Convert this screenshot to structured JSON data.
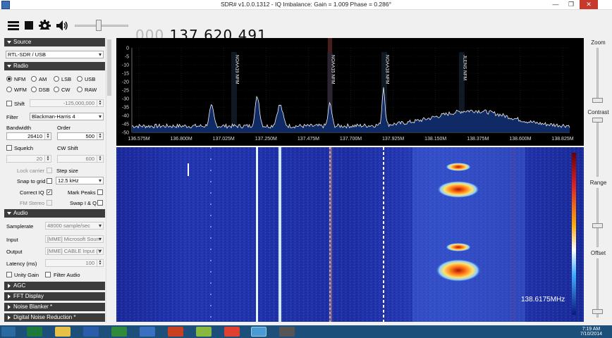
{
  "titlebar": {
    "title": "SDR# v1.0.0.1312 - IQ Imbalance: Gain = 1.009 Phase = 0.286°"
  },
  "toolbar": {
    "freq_dim": "000.",
    "freq_main": "137.620.491"
  },
  "source": {
    "header": "Source",
    "device": "RTL-SDR / USB"
  },
  "radio": {
    "header": "Radio",
    "modes_row1": [
      "NFM",
      "AM",
      "LSB",
      "USB"
    ],
    "modes_row2": [
      "WFM",
      "DSB",
      "CW",
      "RAW"
    ],
    "selected_mode": "NFM",
    "shift_label": "Shift",
    "shift_value": "-125,000,000",
    "filter_label": "Filter",
    "filter_value": "Blackman-Harris 4",
    "bandwidth_label": "Bandwidth",
    "bandwidth_value": "26410",
    "order_label": "Order",
    "order_value": "500",
    "squelch_label": "Squelch",
    "cw_shift_label": "CW Shift",
    "squelch_value": "20",
    "cw_shift_value": "600",
    "lock_carrier_label": "Lock carrier",
    "step_size_label": "Step size",
    "snap_label": "Snap to grid",
    "step_value": "12.5 kHz",
    "correct_iq_label": "Correct IQ",
    "mark_peaks_label": "Mark Peaks",
    "fm_stereo_label": "FM Stereo",
    "swap_iq_label": "Swap I & Q"
  },
  "audio": {
    "header": "Audio",
    "samplerate_label": "Samplerate",
    "samplerate_value": "48000 sample/sec",
    "input_label": "Input",
    "input_value": "[MME] Microsoft Soun",
    "output_label": "Output",
    "output_value": "[MME] CABLE Input (V",
    "latency_label": "Latency (ms)",
    "latency_value": "100",
    "unity_gain_label": "Unity Gain",
    "filter_audio_label": "Filter Audio"
  },
  "collapsed_sections": [
    "AGC",
    "FFT Display",
    "Noise Blanker *",
    "Digital Noise Reduction *"
  ],
  "spectrum": {
    "y_ticks": [
      "0",
      "-5",
      "-10",
      "-15",
      "-20",
      "-25",
      "-30",
      "-35",
      "-40",
      "-45",
      "-50"
    ],
    "x_ticks": [
      "136.575M",
      "136.800M",
      "137.025M",
      "137.250M",
      "137.475M",
      "137.700M",
      "137.925M",
      "138.150M",
      "138.375M",
      "138.600M",
      "138.825M"
    ],
    "markers": [
      {
        "label": "NOAA19 NFM"
      },
      {
        "label": "NOAA15 NFM"
      },
      {
        "label": "NOAA18 NFM"
      },
      {
        "label": "JLENS NFM"
      }
    ]
  },
  "waterfall": {
    "cursor_freq": "138.6175MHz"
  },
  "rightbar": {
    "zoom": "Zoom",
    "contrast": "Contrast",
    "range": "Range",
    "offset": "Offset"
  },
  "taskbar": {
    "time": "7:19 AM",
    "date": "7/10/2014"
  }
}
